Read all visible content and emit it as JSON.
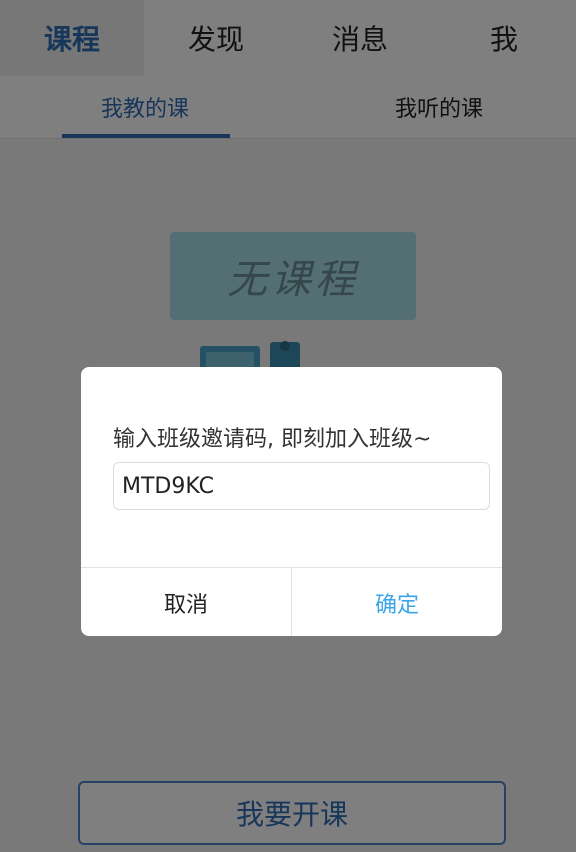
{
  "topnav": {
    "tabs": [
      {
        "label": "课程"
      },
      {
        "label": "发现"
      },
      {
        "label": "消息"
      },
      {
        "label": "我"
      }
    ],
    "active_index": 0
  },
  "subtabs": {
    "items": [
      {
        "label": "我教的课"
      },
      {
        "label": "我听的课"
      }
    ],
    "active_index": 0
  },
  "empty_state": {
    "label": "无课程"
  },
  "create_button": {
    "label": "我要开课"
  },
  "dialog": {
    "message": "输入班级邀请码, 即刻加入班级~",
    "input_value": "MTD9KC",
    "cancel_label": "取消",
    "confirm_label": "确定"
  },
  "colors": {
    "accent": "#2f6db5",
    "confirm": "#3aa6e8"
  }
}
